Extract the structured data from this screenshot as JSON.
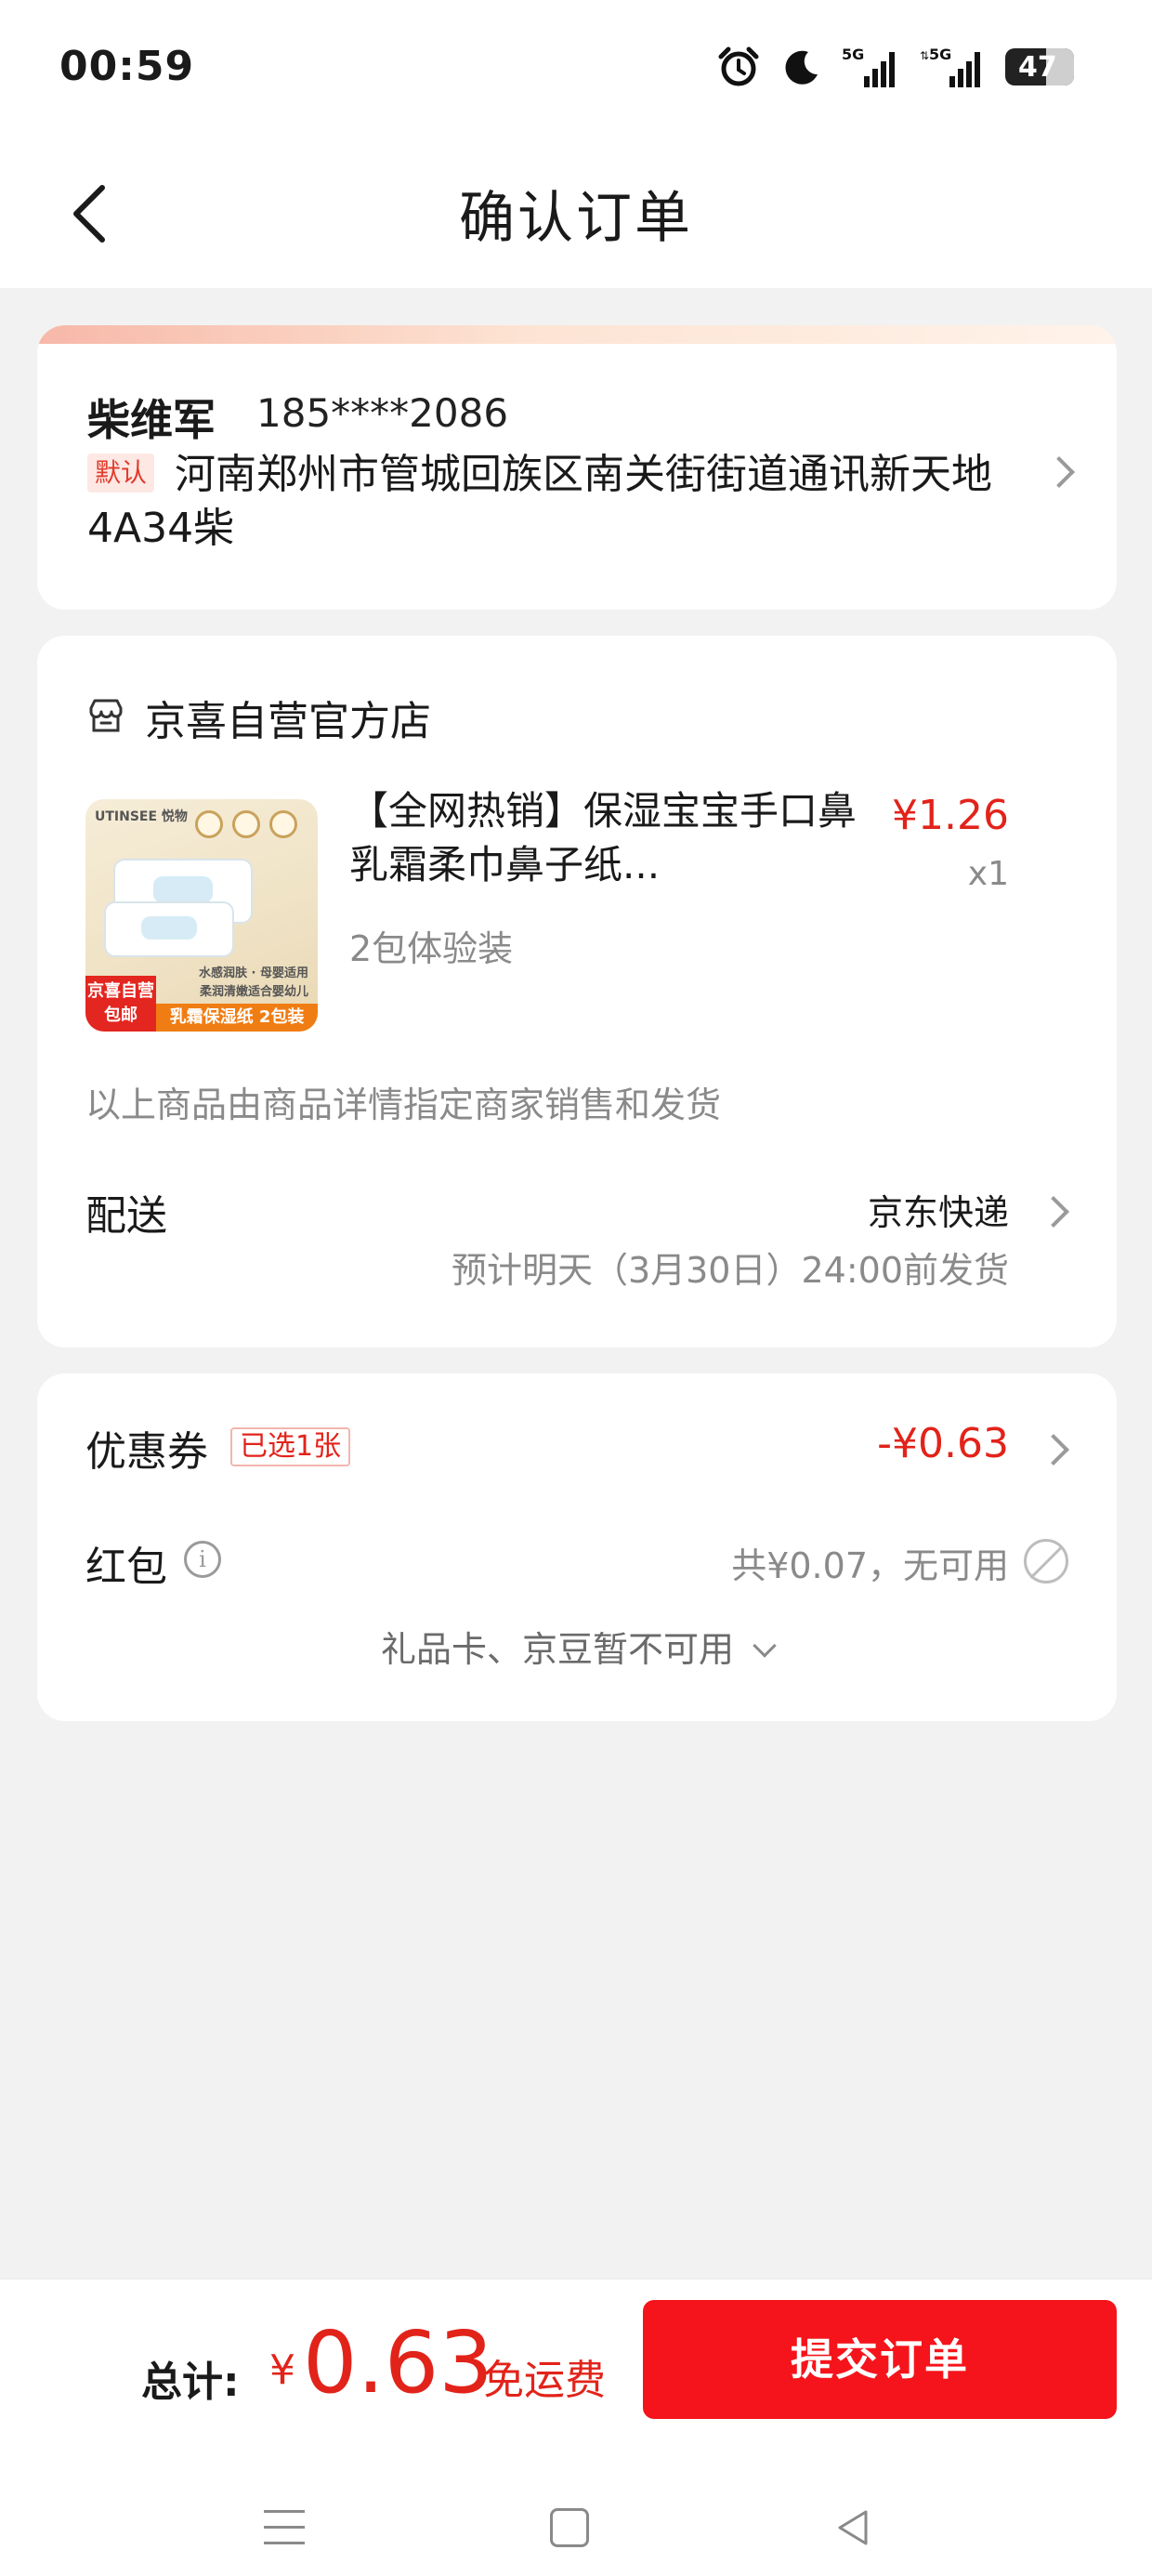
{
  "status_bar": {
    "time": "00:59",
    "battery": "47",
    "network_1": "5G",
    "network_2": "5G"
  },
  "header": {
    "title": "确认订单"
  },
  "address": {
    "name": "柴维军",
    "phone": "185****2086",
    "default_tag": "默认",
    "detail": "河南郑州市管城回族区南关街街道通讯新天地4A34柴"
  },
  "store": {
    "name": "京喜自营官方店"
  },
  "product": {
    "title": "【全网热销】保湿宝宝手口鼻乳霜柔巾鼻子纸...",
    "spec": "2包体验装",
    "price": "¥1.26",
    "quantity": "x1",
    "image": {
      "brand": "UTINSEE 悦物",
      "badge_line1": "京喜自营",
      "badge_line2": "包邮",
      "banner": "乳霜保湿纸 2包装",
      "caption_line1": "水感润肤 · 母婴适用",
      "caption_line2": "柔润清嫩适合婴幼儿"
    }
  },
  "fulfillment": {
    "seller_note": "以上商品由商品详情指定商家销售和发货",
    "shipping_label": "配送",
    "shipping_method": "京东快递",
    "shipping_eta": "预计明天（3月30日）24:00前发货"
  },
  "discounts": {
    "coupon_label": "优惠券",
    "coupon_tag": "已选1张",
    "coupon_value": "-¥0.63",
    "red_packet_label": "红包",
    "red_packet_value": "共¥0.07，无可用",
    "gift_card_note": "礼品卡、京豆暂不可用"
  },
  "footer": {
    "total_label": "总计:",
    "currency": "¥",
    "total_amount": "0.63",
    "free_shipping": "免运费",
    "submit_label": "提交订单"
  },
  "colors": {
    "accent_red": "#e2231a",
    "button_red": "#f5141b",
    "page_bg": "#f2f2f2"
  }
}
